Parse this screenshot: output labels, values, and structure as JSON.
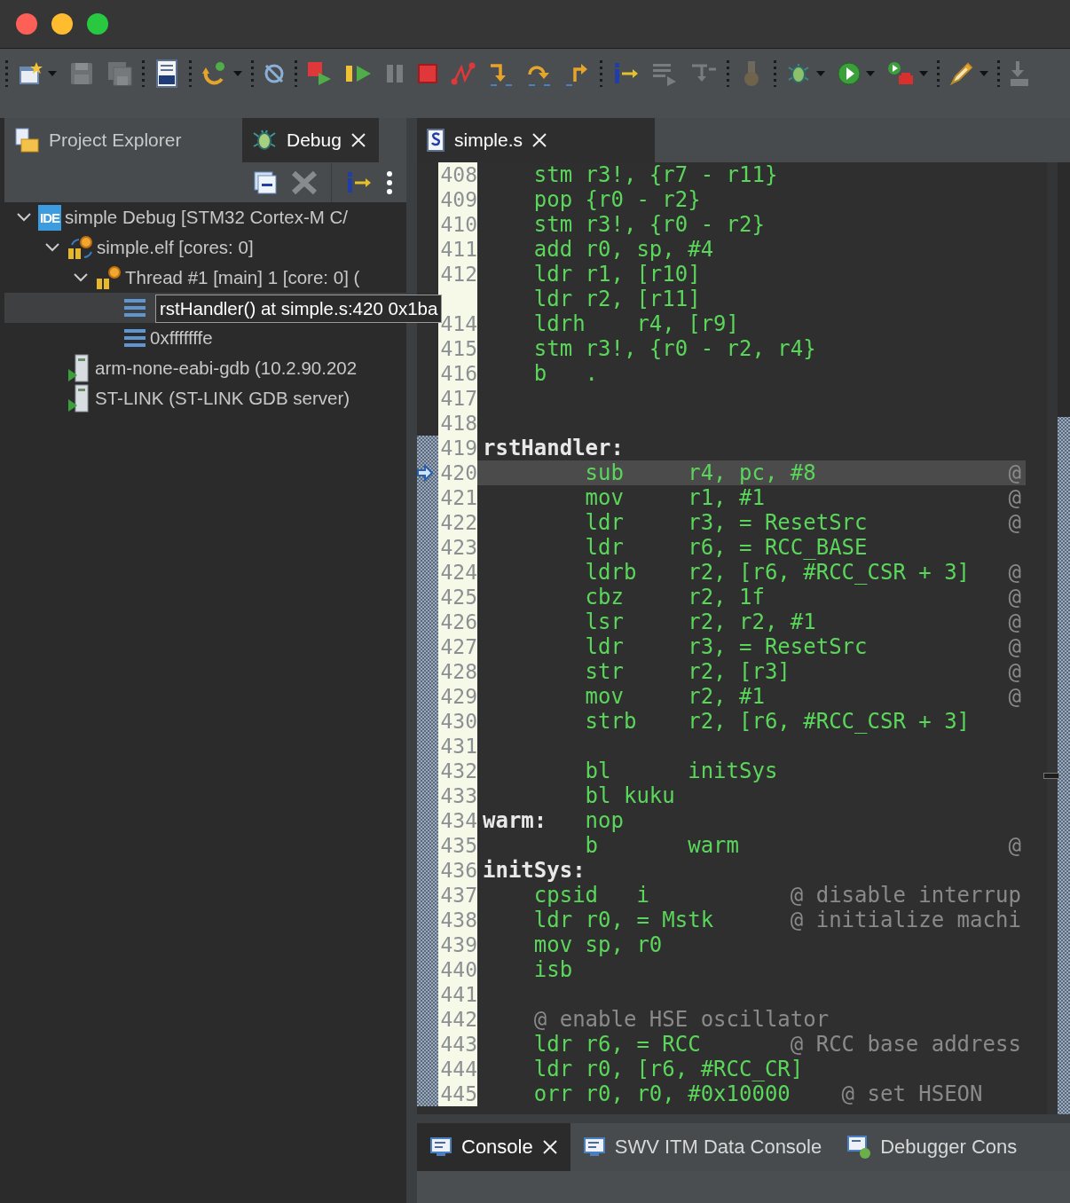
{
  "toolbar": [
    {
      "kind": "new",
      "disabled": false,
      "dropdown": true
    },
    {
      "kind": "save",
      "disabled": true,
      "dropdown": false
    },
    {
      "kind": "save-all",
      "disabled": true,
      "dropdown": false
    },
    {
      "kind": "separator"
    },
    {
      "kind": "binary",
      "disabled": false,
      "dropdown": false
    },
    {
      "kind": "separator"
    },
    {
      "kind": "refresh",
      "disabled": false,
      "dropdown": true
    },
    {
      "kind": "separator"
    },
    {
      "kind": "skip",
      "disabled": false,
      "dropdown": false
    },
    {
      "kind": "separator"
    },
    {
      "kind": "relaunch",
      "disabled": false,
      "dropdown": false
    },
    {
      "kind": "resume",
      "disabled": false,
      "dropdown": false
    },
    {
      "kind": "suspend",
      "disabled": true,
      "dropdown": false
    },
    {
      "kind": "terminate",
      "disabled": false,
      "dropdown": false
    },
    {
      "kind": "disconnect",
      "disabled": false,
      "dropdown": false
    },
    {
      "kind": "step-into",
      "disabled": false,
      "dropdown": false
    },
    {
      "kind": "step-over",
      "disabled": false,
      "dropdown": false
    },
    {
      "kind": "step-return",
      "disabled": false,
      "dropdown": false
    },
    {
      "kind": "separator"
    },
    {
      "kind": "instruction",
      "disabled": false,
      "dropdown": false
    },
    {
      "kind": "drop-frame",
      "disabled": true,
      "dropdown": false
    },
    {
      "kind": "filters",
      "disabled": true,
      "dropdown": false
    },
    {
      "kind": "separator"
    },
    {
      "kind": "plug",
      "disabled": true,
      "dropdown": false
    },
    {
      "kind": "separator"
    },
    {
      "kind": "debug",
      "disabled": false,
      "dropdown": true
    },
    {
      "kind": "run",
      "disabled": false,
      "dropdown": true
    },
    {
      "kind": "external",
      "disabled": false,
      "dropdown": true
    },
    {
      "kind": "separator"
    },
    {
      "kind": "pen",
      "disabled": false,
      "dropdown": true
    },
    {
      "kind": "separator"
    },
    {
      "kind": "download",
      "disabled": true,
      "dropdown": false
    }
  ],
  "left_tabs": [
    {
      "label": "Project Explorer",
      "kind": "explorer",
      "selected": false,
      "closable": false
    },
    {
      "label": "Debug",
      "kind": "bug",
      "selected": true,
      "closable": true
    }
  ],
  "debug_tree": [
    {
      "kind": "launch",
      "badge": "IDE",
      "label": "simple Debug [STM32 Cortex-M C/",
      "expanded": true,
      "selected": false,
      "children": [
        {
          "kind": "process",
          "label": "simple.elf [cores: 0]",
          "expanded": true,
          "selected": false,
          "children": [
            {
              "kind": "thread",
              "label": "Thread #1 [main] 1 [core: 0] (",
              "expanded": true,
              "selected": false,
              "children": [
                {
                  "kind": "frame",
                  "tooltip": "rstHandler() at simple.s:420 0x1ba",
                  "selected": true
                },
                {
                  "kind": "frame",
                  "label": "0xfffffffe",
                  "selected": false
                }
              ]
            }
          ]
        },
        {
          "kind": "server",
          "label": "arm-none-eabi-gdb (10.2.90.202",
          "selected": false
        },
        {
          "kind": "server",
          "label": "ST-LINK (ST-LINK GDB server)",
          "selected": false
        }
      ]
    }
  ],
  "editor_tab": {
    "label": "simple.s",
    "selected": true
  },
  "lines": [
    {
      "num": "408",
      "code": "    stm r3!, {r7 - r11}",
      "in_range": false,
      "current": false
    },
    {
      "num": "409",
      "code": "    pop {r0 - r2}",
      "in_range": false,
      "current": false
    },
    {
      "num": "410",
      "code": "    stm r3!, {r0 - r2}",
      "in_range": false,
      "current": false
    },
    {
      "num": "411",
      "code": "    add r0, sp, #4",
      "in_range": false,
      "current": false
    },
    {
      "num": "412",
      "code": "    ldr r1, [r10]",
      "in_range": false,
      "current": false
    },
    {
      "code": "    ldr r2, [r11]",
      "in_range": false,
      "current": false
    },
    {
      "num": "414",
      "code": "    ldrh    r4, [r9]",
      "in_range": false,
      "current": false
    },
    {
      "num": "415",
      "code": "    stm r3!, {r0 - r2, r4}",
      "in_range": false,
      "current": false
    },
    {
      "num": "416",
      "code": "    b   .",
      "in_range": false,
      "current": false
    },
    {
      "num": "417",
      "in_range": false,
      "current": false
    },
    {
      "num": "418",
      "in_range": false,
      "current": false
    },
    {
      "num": "419",
      "label": "rstHandler:",
      "in_range": true,
      "current": false
    },
    {
      "num": "420",
      "code": "        sub     r4, pc, #8               ",
      "comment": "@",
      "in_range": true,
      "current": true
    },
    {
      "num": "421",
      "code": "        mov     r1, #1                   ",
      "comment": "@",
      "in_range": true,
      "current": false
    },
    {
      "num": "422",
      "code": "        ldr     r3, = ResetSrc           ",
      "comment": "@",
      "in_range": true,
      "current": false
    },
    {
      "num": "423",
      "code": "        ldr     r6, = RCC_BASE",
      "in_range": true,
      "current": false
    },
    {
      "num": "424",
      "code": "        ldrb    r2, [r6, #RCC_CSR + 3]   ",
      "comment": "@",
      "in_range": true,
      "current": false
    },
    {
      "num": "425",
      "code": "        cbz     r2, 1f                   ",
      "comment": "@",
      "in_range": true,
      "current": false
    },
    {
      "num": "426",
      "code": "        lsr     r2, r2, #1               ",
      "comment": "@",
      "in_range": true,
      "current": false
    },
    {
      "num": "427",
      "code": "        ldr     r3, = ResetSrc           ",
      "comment": "@",
      "in_range": true,
      "current": false
    },
    {
      "num": "428",
      "code": "        str     r2, [r3]                 ",
      "comment": "@",
      "in_range": true,
      "current": false
    },
    {
      "num": "429",
      "code": "        mov     r2, #1                   ",
      "comment": "@",
      "in_range": true,
      "current": false
    },
    {
      "num": "430",
      "code": "        strb    r2, [r6, #RCC_CSR + 3]",
      "in_range": true,
      "current": false
    },
    {
      "num": "431",
      "in_range": true,
      "current": false
    },
    {
      "num": "432",
      "code": "        bl      initSys",
      "in_range": true,
      "current": false
    },
    {
      "num": "433",
      "code": "        bl kuku",
      "in_range": true,
      "current": false
    },
    {
      "num": "434",
      "label": "warm:",
      "code": "   nop",
      "in_range": true,
      "current": false
    },
    {
      "num": "435",
      "code": "        b       warm                     ",
      "comment": "@",
      "in_range": true,
      "current": false
    },
    {
      "num": "436",
      "label": "initSys:",
      "in_range": true,
      "current": false
    },
    {
      "num": "437",
      "code": "    cpsid   i           ",
      "comment": "@ disable interrup",
      "in_range": true,
      "current": false
    },
    {
      "num": "438",
      "code": "    ldr r0, = Mstk      ",
      "comment": "@ initialize machi",
      "in_range": true,
      "current": false
    },
    {
      "num": "439",
      "code": "    mov sp, r0",
      "in_range": true,
      "current": false
    },
    {
      "num": "440",
      "code": "    isb",
      "in_range": true,
      "current": false
    },
    {
      "num": "441",
      "in_range": true,
      "current": false
    },
    {
      "num": "442",
      "comment": "    @ enable HSE oscillator",
      "in_range": true,
      "current": false
    },
    {
      "num": "443",
      "code": "    ldr r6, = RCC       ",
      "comment": "@ RCC base address",
      "in_range": true,
      "current": false
    },
    {
      "num": "444",
      "code": "    ldr r0, [r6, #RCC_CR]",
      "in_range": true,
      "current": false
    },
    {
      "num": "445",
      "code": "    orr r0, r0, #0x10000    ",
      "comment": "@ set HSEON",
      "in_range": true,
      "current": false
    }
  ],
  "bottom_tabs": [
    {
      "label": "Console",
      "kind": "console",
      "selected": true,
      "closable": true
    },
    {
      "label": "SWV ITM Data Console",
      "kind": "console",
      "selected": false,
      "closable": false
    },
    {
      "label": "Debugger Cons",
      "kind": "debugger",
      "selected": false,
      "closable": false
    }
  ]
}
